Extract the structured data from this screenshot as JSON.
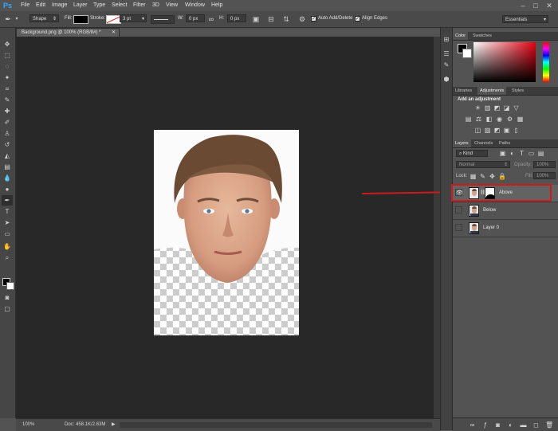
{
  "menubar": {
    "logo": "Ps",
    "items": [
      "File",
      "Edit",
      "Image",
      "Layer",
      "Type",
      "Select",
      "Filter",
      "3D",
      "View",
      "Window",
      "Help"
    ],
    "window_controls": {
      "minimize": "–",
      "maximize": "□",
      "close": "✕"
    }
  },
  "options": {
    "mode": "Shape",
    "fill_label": "Fill:",
    "stroke_label": "Stroke:",
    "stroke_width": "3 pt",
    "w_label": "W:",
    "w_value": "0 px",
    "h_label": "H:",
    "h_value": "0 px",
    "auto_add_delete": "Auto Add/Delete",
    "align_edges": "Align Edges",
    "workspace": "Essentials"
  },
  "document": {
    "tab_title": "Background.png @ 100% (RGB/8#) *",
    "zoom": "100%",
    "doc_info": "Doc: 458.1K/2.63M"
  },
  "panels": {
    "color_tabs": [
      "Color",
      "Swatches"
    ],
    "adjust_tabs": [
      "Libraries",
      "Adjustments",
      "Styles"
    ],
    "add_adjustment": "Add an adjustment",
    "layers_tabs": [
      "Layers",
      "Channels",
      "Paths"
    ],
    "filter_kind": "Kind",
    "blend_mode": "Normal",
    "opacity_label": "Opacity:",
    "opacity_value": "100%",
    "lock_label": "Lock:",
    "fill_label": "Fill:",
    "fill_value": "100%",
    "layers": [
      {
        "name": "Above",
        "visible": true,
        "selected": true
      },
      {
        "name": "Below",
        "visible": false,
        "selected": false
      },
      {
        "name": "Layer 0",
        "visible": false,
        "selected": false
      }
    ]
  },
  "colors": {
    "annotation_red": "#d0191b",
    "selection": "#636363"
  }
}
